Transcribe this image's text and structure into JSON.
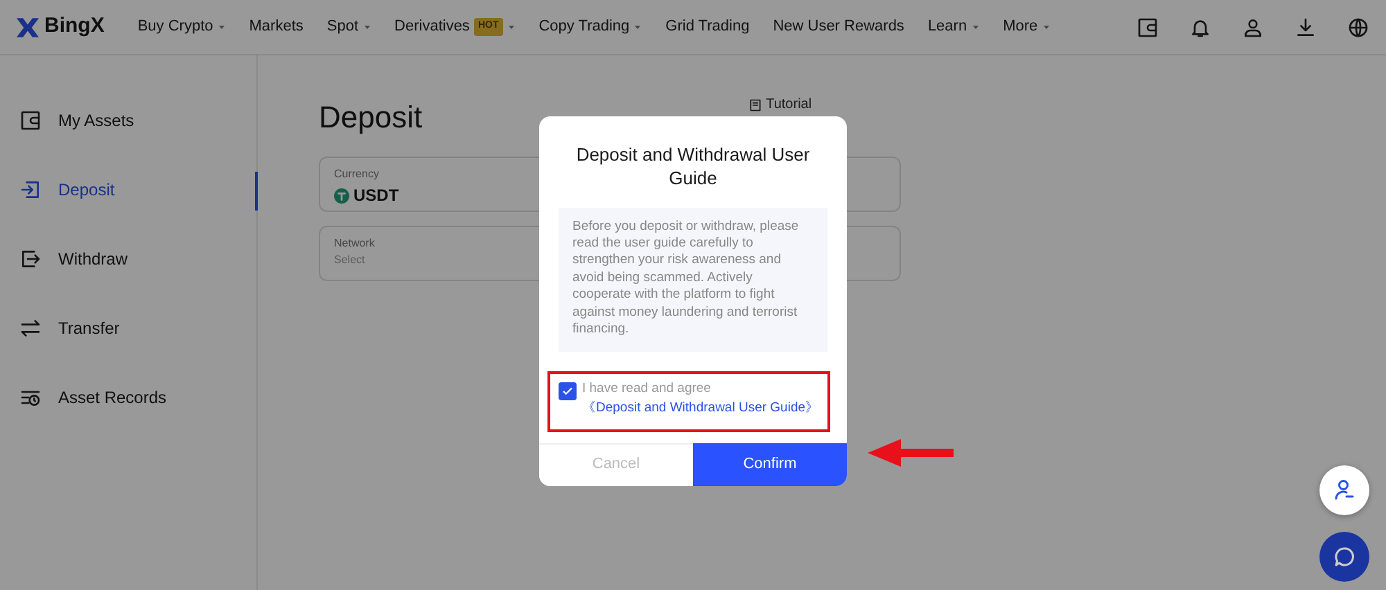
{
  "navbar": {
    "logo": "BingX",
    "items": [
      {
        "label": "Buy Crypto",
        "dropdown": true
      },
      {
        "label": "Markets",
        "dropdown": false
      },
      {
        "label": "Spot",
        "dropdown": true
      },
      {
        "label": "Derivatives",
        "dropdown": true,
        "badge": "HOT"
      },
      {
        "label": "Copy Trading",
        "dropdown": true
      },
      {
        "label": "Grid Trading",
        "dropdown": false
      },
      {
        "label": "New User Rewards",
        "dropdown": false
      },
      {
        "label": "Learn",
        "dropdown": true
      },
      {
        "label": "More",
        "dropdown": true
      }
    ]
  },
  "sidebar": {
    "items": [
      {
        "label": "My Assets",
        "kind": "wallet",
        "selected": false
      },
      {
        "label": "Deposit",
        "kind": "deposit",
        "selected": true
      },
      {
        "label": "Withdraw",
        "kind": "withdraw",
        "selected": false
      },
      {
        "label": "Transfer",
        "kind": "transfer",
        "selected": false
      },
      {
        "label": "Asset Records",
        "kind": "records",
        "selected": false
      }
    ]
  },
  "page": {
    "title": "Deposit",
    "tutorial": "Tutorial",
    "fields": [
      {
        "label": "Currency",
        "value": "USDT"
      },
      {
        "label": "Network",
        "hint": "Select"
      }
    ]
  },
  "modal": {
    "title": "Deposit and Withdrawal User Guide",
    "notice": "Before you deposit or withdraw, please read the user guide carefully to strengthen your risk awareness and avoid being scammed. Actively cooperate with the platform to fight against money laundering and terrorist financing.",
    "agree": {
      "checked": true,
      "text": "I have read and agree",
      "link": "《Deposit and Withdrawal User Guide》"
    },
    "buttons": [
      {
        "label": "Cancel",
        "kind": "secondary"
      },
      {
        "label": "Confirm",
        "kind": "primary"
      }
    ]
  }
}
